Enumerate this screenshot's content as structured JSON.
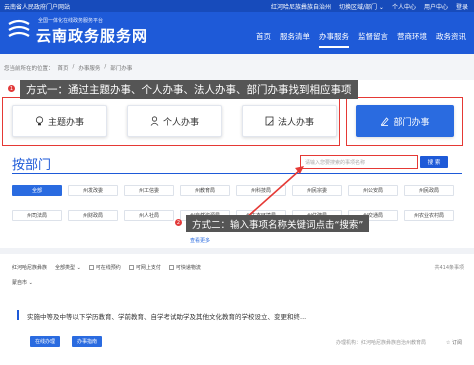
{
  "topbar": {
    "site": "云南省人民政府门户网站",
    "region": "红河哈尼族彝族自治州",
    "switch": "切换区域/部门 ⌄",
    "center": "个人中心",
    "user": "用户中心",
    "login": "登录"
  },
  "header": {
    "subtitle": "全国一体化在线政务服务平台",
    "title": "云南政务服务网"
  },
  "nav": [
    "首页",
    "服务清单",
    "办事服务",
    "监督留言",
    "营商环境",
    "政务资讯"
  ],
  "breadcrumb": {
    "prefix": "您当前所在的位置：",
    "items": [
      "首页",
      "办事服务",
      "部门办事"
    ],
    "sep": "/"
  },
  "annotation1": {
    "num": "1",
    "text": "方式一：通过主题办事、个人办事、法人办事、部门办事找到相应事项"
  },
  "service_cards": [
    {
      "label": "主题办事",
      "icon": "bulb-icon"
    },
    {
      "label": "个人办事",
      "icon": "person-icon"
    },
    {
      "label": "法人办事",
      "icon": "building-icon"
    },
    {
      "label": "部门办事",
      "icon": "pen-icon"
    }
  ],
  "dept": {
    "title": "按部门",
    "search_placeholder": "请输入您要搜索的事项名称",
    "search_btn": "搜 索"
  },
  "chips_row1": [
    "全部",
    "州发改委",
    "州工信委",
    "州教育局",
    "州科技局",
    "州民宗委",
    "州公安局",
    "州民政局"
  ],
  "chips_row2": [
    "州司法局",
    "州财政局",
    "州人社局",
    "州自然资源局",
    "州生态环境局",
    "州住建局",
    "州交通局",
    "州农业农村局"
  ],
  "annotation2": {
    "num": "2",
    "text": "方式二：输入事项名称关键词点击“搜索”"
  },
  "more_link": "查看更多",
  "filters": {
    "label": "红河哈尼族彝族",
    "type": "全部类型 ⌄",
    "opt1": "可在线预约",
    "opt2": "可网上支付",
    "opt3": "可快递物流",
    "total": "共414条事项",
    "region": "蒙自市 ⌄"
  },
  "list_item": {
    "title": "实施中等及中等以下学历教育、学前教育、自学考试助学及其他文化教育的学校设立、变更和终...",
    "btn1": "在线办理",
    "btn2": "办事指南",
    "meta": "办理机构：红河哈尼族彝族自治州教育局",
    "subscribe": "☆ 订阅"
  },
  "colors": {
    "brand": "#1e5ad8",
    "annotation": "#e53935"
  }
}
